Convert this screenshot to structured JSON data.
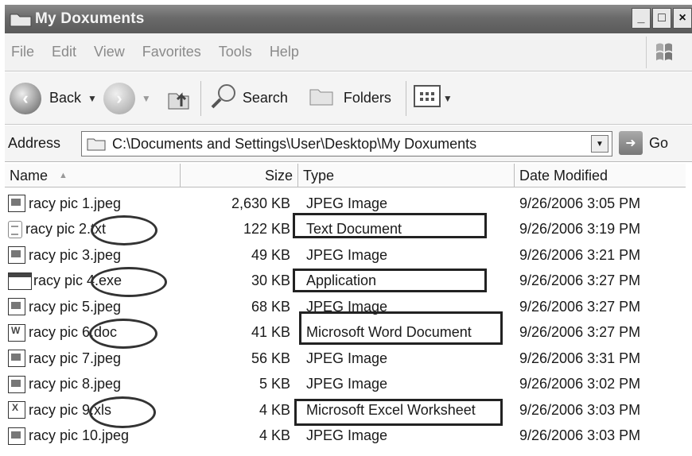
{
  "window": {
    "title": "My Doxuments",
    "controls": [
      "_",
      "□",
      "×"
    ]
  },
  "menu": [
    "File",
    "Edit",
    "View",
    "Favorites",
    "Tools",
    "Help"
  ],
  "toolbar": {
    "back_label": "Back",
    "search_label": "Search",
    "folders_label": "Folders"
  },
  "address": {
    "label": "Address",
    "value": "C:\\Documents and Settings\\User\\Desktop\\My Doxuments",
    "go_label": "Go"
  },
  "columns": {
    "name": "Name",
    "size": "Size",
    "type": "Type",
    "date": "Date Modified"
  },
  "files": [
    {
      "name": "racy pic 1.jpeg",
      "size": "2,630 KB",
      "type": "JPEG Image",
      "date": "9/26/2006 3:05 PM",
      "icon": "image-file-icon"
    },
    {
      "name": "racy pic 2.txt",
      "size": "122 KB",
      "type": "Text Document",
      "date": "9/26/2006 3:19 PM",
      "icon": "text-file-icon"
    },
    {
      "name": "racy pic 3.jpeg",
      "size": "49 KB",
      "type": "JPEG Image",
      "date": "9/26/2006 3:21 PM",
      "icon": "image-file-icon"
    },
    {
      "name": "racy pic 4.exe",
      "size": "30 KB",
      "type": "Application",
      "date": "9/26/2006 3:27 PM",
      "icon": "application-file-icon"
    },
    {
      "name": "racy pic 5.jpeg",
      "size": "68 KB",
      "type": "JPEG Image",
      "date": "9/26/2006 3:27 PM",
      "icon": "image-file-icon"
    },
    {
      "name": "racy pic 6.doc",
      "size": "41 KB",
      "type": "Microsoft Word Document",
      "date": "9/26/2006 3:27 PM",
      "icon": "word-file-icon"
    },
    {
      "name": "racy pic 7.jpeg",
      "size": "56 KB",
      "type": "JPEG Image",
      "date": "9/26/2006 3:31 PM",
      "icon": "image-file-icon"
    },
    {
      "name": "racy pic 8.jpeg",
      "size": "5 KB",
      "type": "JPEG Image",
      "date": "9/26/2006 3:02 PM",
      "icon": "image-file-icon"
    },
    {
      "name": "racy pic 9.xls",
      "size": "4 KB",
      "type": "Microsoft Excel Worksheet",
      "date": "9/26/2006 3:03 PM",
      "icon": "excel-file-icon"
    },
    {
      "name": "racy pic 10.jpeg",
      "size": "4 KB",
      "type": "JPEG Image",
      "date": "9/26/2006 3:03 PM",
      "icon": "image-file-icon"
    }
  ]
}
